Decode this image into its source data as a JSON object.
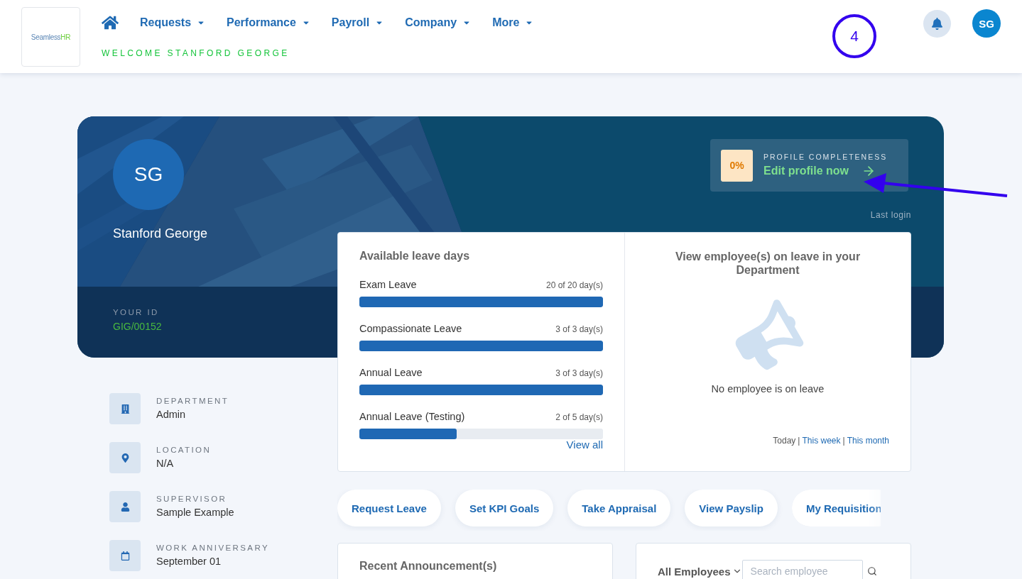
{
  "header": {
    "logo": {
      "text": "Seamless",
      "accent": "HR"
    },
    "nav": [
      {
        "label": "Requests"
      },
      {
        "label": "Performance"
      },
      {
        "label": "Payroll"
      },
      {
        "label": "Company"
      },
      {
        "label": "More"
      }
    ],
    "welcome": "WELCOME STANFORD GEORGE",
    "avatar": "SG"
  },
  "annotation": {
    "marker": "4"
  },
  "profile": {
    "initials": "SG",
    "name": "Stanford George",
    "completeness_label": "PROFILE COMPLETENESS",
    "completeness": "0%",
    "edit_link": "Edit profile now",
    "last_login": "Last login",
    "id_label": "YOUR ID",
    "id": "GIG/00152"
  },
  "details": [
    {
      "kind": "department",
      "label": "DEPARTMENT",
      "value": "Admin"
    },
    {
      "kind": "location",
      "label": "LOCATION",
      "value": "N/A"
    },
    {
      "kind": "supervisor",
      "label": "SUPERVISOR",
      "value": "Sample Example"
    },
    {
      "kind": "anniversary",
      "label": "WORK ANNIVERSARY",
      "value": "September 01"
    }
  ],
  "leave": {
    "title": "Available leave days",
    "items": [
      {
        "name": "Exam Leave",
        "reading": "20 of 20 day(s)",
        "level": 1
      },
      {
        "name": "Compassionate Leave",
        "reading": "3 of 3 day(s)",
        "level": 1
      },
      {
        "name": "Annual Leave",
        "reading": "3 of 3 day(s)",
        "level": 1
      },
      {
        "name": "Annual Leave (Testing)",
        "reading": "2 of 5 day(s)",
        "level": 0.4
      }
    ],
    "view_all": "View all"
  },
  "on_leave": {
    "title": "View employee(s) on leave in your Department",
    "empty": "No employee is on leave",
    "separator": "|",
    "filters": [
      {
        "label": "Today",
        "selected": true
      },
      {
        "label": "This week",
        "selected": false
      },
      {
        "label": "This month",
        "selected": false
      }
    ]
  },
  "quick_actions": [
    "Request Leave",
    "Set KPI Goals",
    "Take Appraisal",
    "View Payslip",
    "My Requisition"
  ],
  "announcements": {
    "title": "Recent Announcement(s)"
  },
  "employees": {
    "filter": "All Employees",
    "search": {
      "placeholder": "Search employee"
    }
  }
}
